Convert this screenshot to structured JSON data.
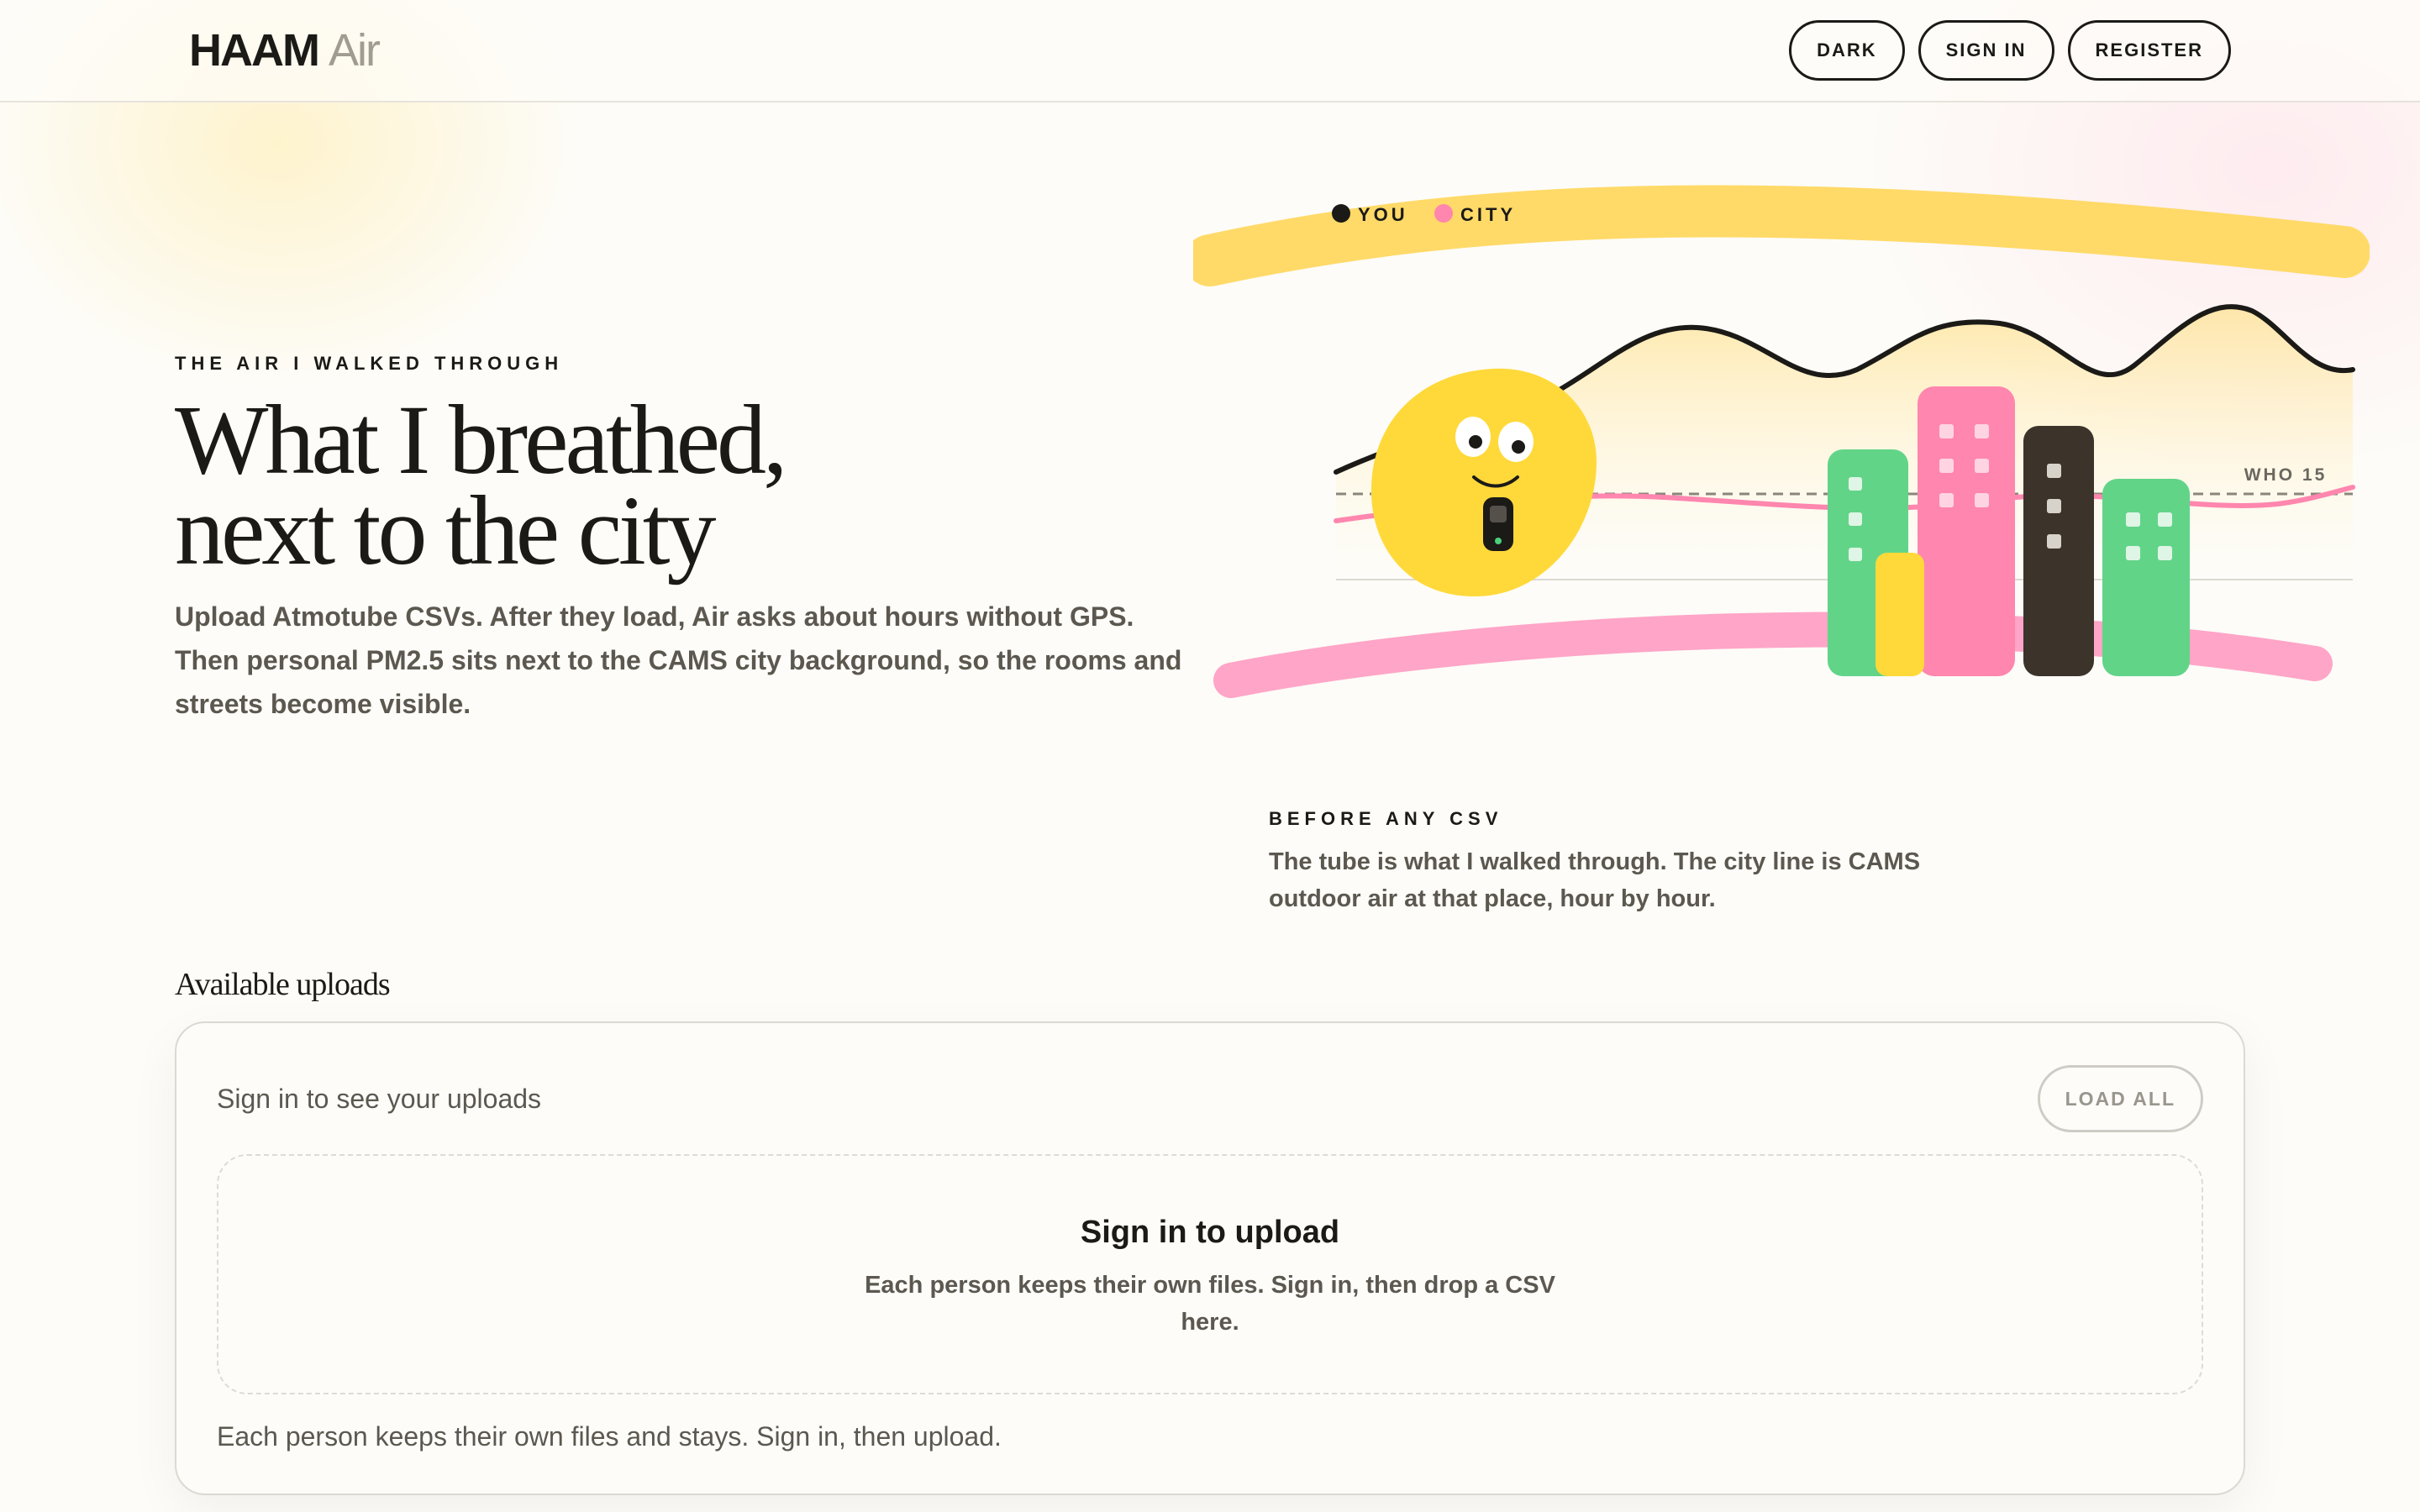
{
  "header": {
    "brand_main": "HAAM",
    "brand_sub": "Air",
    "nav": {
      "dark_label": "DARK",
      "sign_in_label": "SIGN IN",
      "register_label": "REGISTER"
    }
  },
  "hero": {
    "eyebrow": "THE AIR I WALKED THROUGH",
    "title_line1": "What I breathed,",
    "title_line2": "next to the city",
    "body": "Upload Atmotube CSVs. After they load, Air asks about hours without GPS. Then personal PM2.5 sits next to the CAMS city background, so the rooms and streets become visible."
  },
  "illustration": {
    "legend": {
      "you_label": "YOU",
      "city_label": "CITY"
    },
    "reference_label": "WHO 15",
    "colors": {
      "yellow": "#ffd860",
      "pink": "#ffa0c4",
      "green": "#62d488",
      "hot_pink": "#ff86ae",
      "dark": "#3c342b",
      "face": "#ffd93a"
    }
  },
  "note": {
    "eyebrow": "BEFORE ANY CSV",
    "body": "The tube is what I walked through. The city line is CAMS outdoor air at that place, hour by hour."
  },
  "uploads": {
    "heading": "Available uploads",
    "status": "Sign in to see your uploads",
    "load_all_label": "LOAD ALL",
    "dropzone_title": "Sign in to upload",
    "dropzone_body": "Each person keeps their own files. Sign in, then drop a CSV here.",
    "footer": "Each person keeps their own files and stays. Sign in, then upload."
  }
}
